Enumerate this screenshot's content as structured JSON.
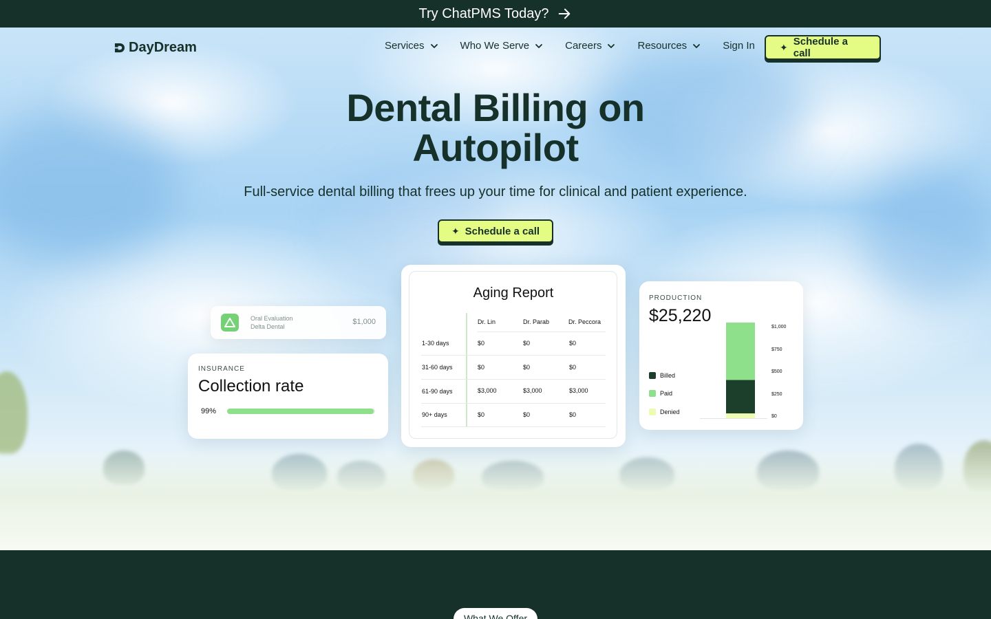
{
  "announcement": {
    "text": "Try ChatPMS Today?"
  },
  "nav": {
    "logo": "DayDream",
    "items": [
      "Services",
      "Who We Serve",
      "Careers",
      "Resources"
    ],
    "sign_in": "Sign In",
    "cta": "Schedule a call"
  },
  "hero": {
    "headline_line1": "Dental Billing on",
    "headline_line2": "Autopilot",
    "subline": "Full-service dental billing that frees up your time for clinical and patient experience.",
    "cta": "Schedule a call"
  },
  "claim_card": {
    "title": "Oral Evaluation",
    "subtitle": "Delta Dental",
    "amount": "$1,000"
  },
  "collection_card": {
    "label": "INSURANCE",
    "title": "Collection rate",
    "percent_text": "99%",
    "percent": 99
  },
  "aging_report": {
    "title": "Aging Report",
    "columns": [
      "Dr. Lin",
      "Dr. Parab",
      "Dr. Peccora"
    ],
    "rows": [
      {
        "label": "1-30 days",
        "values": [
          "$0",
          "$0",
          "$0"
        ]
      },
      {
        "label": "31-60 days",
        "values": [
          "$0",
          "$0",
          "$0"
        ]
      },
      {
        "label": "61-90 days",
        "values": [
          "$3,000",
          "$3,000",
          "$3,000"
        ]
      },
      {
        "label": "90+ days",
        "values": [
          "$0",
          "$0",
          "$0"
        ]
      }
    ]
  },
  "production_card": {
    "label": "PRODUCTION",
    "value": "$25,220",
    "legend": [
      {
        "name": "Billed",
        "color": "#1b3f2a"
      },
      {
        "name": "Paid",
        "color": "#8ee08a"
      },
      {
        "name": "Denied",
        "color": "#ecfcb0"
      }
    ],
    "ticks": [
      "$1,000",
      "$750",
      "$500",
      "$250",
      "$0"
    ],
    "stack": {
      "Denied": 50,
      "Billed": 350,
      "Paid": 600,
      "max": 1000
    }
  },
  "offer": {
    "pill": "What We Offer"
  },
  "colors": {
    "dark": "#16302a",
    "accent": "#e5fc84",
    "green": "#8ee08a"
  }
}
